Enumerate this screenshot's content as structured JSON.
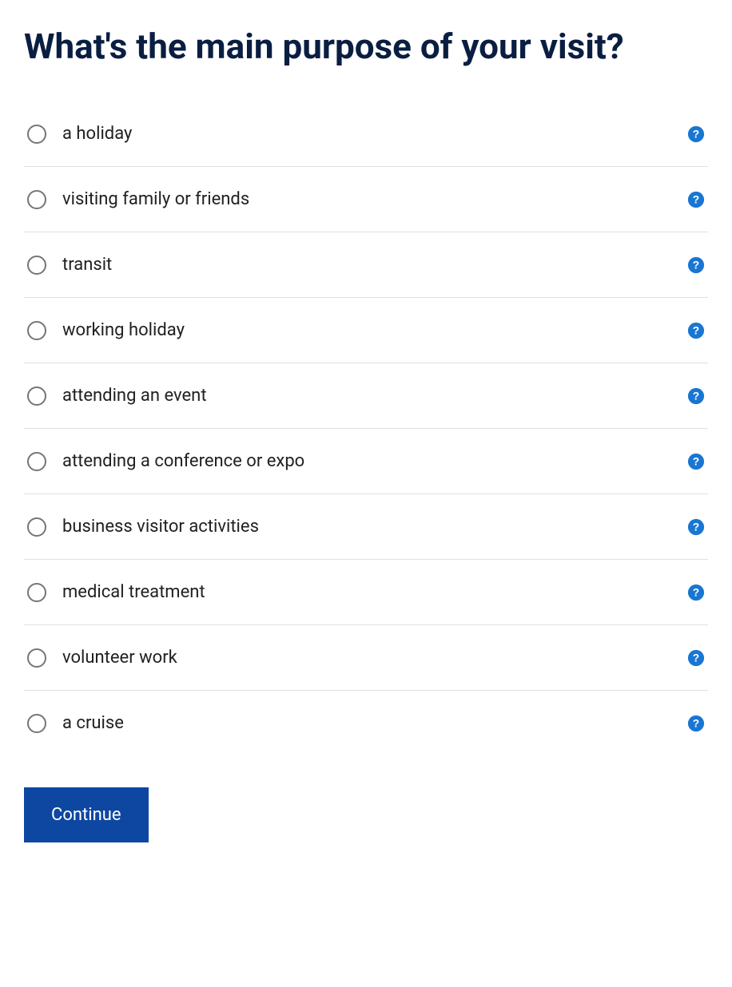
{
  "title": "What's the main purpose of your visit?",
  "options": [
    {
      "label": "a holiday"
    },
    {
      "label": "visiting family or friends"
    },
    {
      "label": "transit"
    },
    {
      "label": "working holiday"
    },
    {
      "label": "attending an event"
    },
    {
      "label": "attending a conference or expo"
    },
    {
      "label": "business visitor activities"
    },
    {
      "label": "medical treatment"
    },
    {
      "label": "volunteer work"
    },
    {
      "label": "a cruise"
    }
  ],
  "continue_label": "Continue"
}
